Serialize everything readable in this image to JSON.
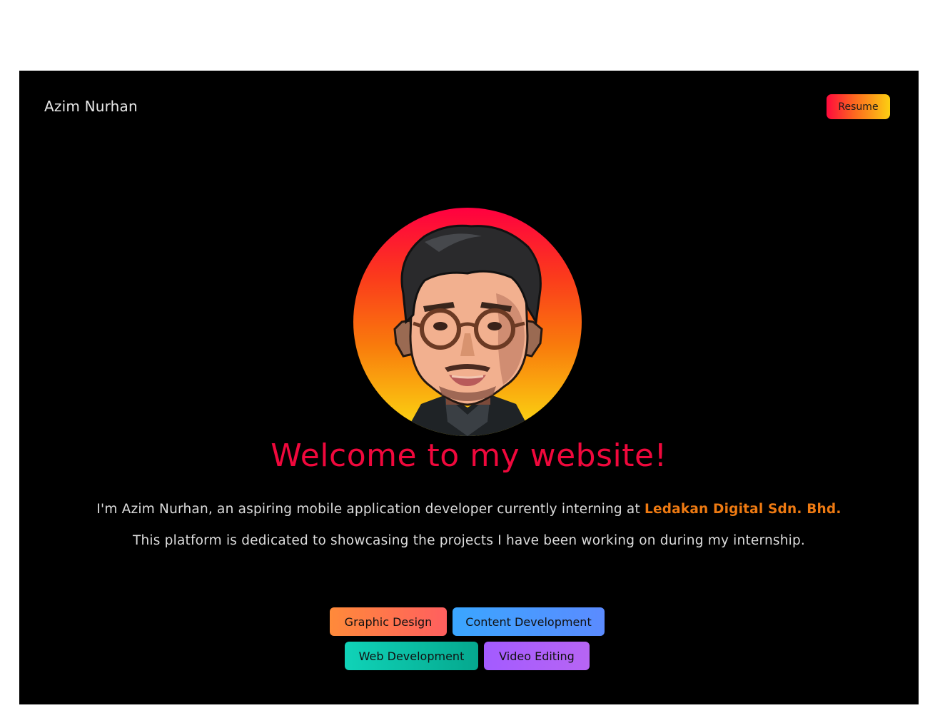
{
  "header": {
    "brand": "Azim Nurhan",
    "resume_label": "Resume"
  },
  "hero": {
    "avatar_alt": "pixel-art portrait",
    "title": "Welcome to my website!",
    "intro_prefix": "I'm Azim Nurhan, an aspiring mobile application developer currently interning at ",
    "company": "Ledakan Digital Sdn. Bhd.",
    "description": "This platform is dedicated to showcasing the projects I have been working on during my internship."
  },
  "categories": [
    {
      "label": "Graphic Design"
    },
    {
      "label": "Content Development"
    },
    {
      "label": "Web Development"
    },
    {
      "label": "Video Editing"
    }
  ],
  "colors": {
    "background": "#000000",
    "title": "#f0083c",
    "company": "#ee7a12",
    "text": "#dcdcdc"
  }
}
